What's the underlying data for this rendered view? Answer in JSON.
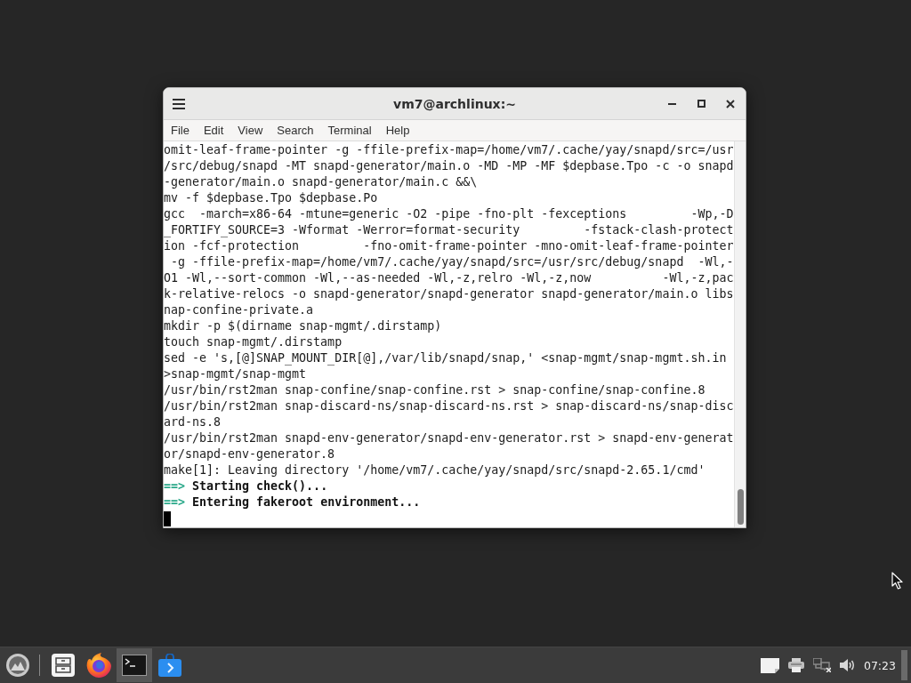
{
  "window": {
    "title": "vm7@archlinux:~"
  },
  "menu_bar": [
    "File",
    "Edit",
    "View",
    "Search",
    "Terminal",
    "Help"
  ],
  "terminal": {
    "lines": [
      {
        "kind": "output",
        "text": "omit-leaf-frame-pointer -g -ffile-prefix-map=/home/vm7/.cache/yay/snapd/src=/usr"
      },
      {
        "kind": "output",
        "text": "/src/debug/snapd -MT snapd-generator/main.o -MD -MP -MF $depbase.Tpo -c -o snapd"
      },
      {
        "kind": "output",
        "text": "-generator/main.o snapd-generator/main.c &&\\"
      },
      {
        "kind": "output",
        "text": "mv -f $depbase.Tpo $depbase.Po"
      },
      {
        "kind": "output",
        "text": "gcc  -march=x86-64 -mtune=generic -O2 -pipe -fno-plt -fexceptions         -Wp,-D"
      },
      {
        "kind": "output",
        "text": "_FORTIFY_SOURCE=3 -Wformat -Werror=format-security         -fstack-clash-protect"
      },
      {
        "kind": "output",
        "text": "ion -fcf-protection         -fno-omit-frame-pointer -mno-omit-leaf-frame-pointer"
      },
      {
        "kind": "output",
        "text": " -g -ffile-prefix-map=/home/vm7/.cache/yay/snapd/src=/usr/src/debug/snapd  -Wl,-"
      },
      {
        "kind": "output",
        "text": "O1 -Wl,--sort-common -Wl,--as-needed -Wl,-z,relro -Wl,-z,now          -Wl,-z,pac"
      },
      {
        "kind": "output",
        "text": "k-relative-relocs -o snapd-generator/snapd-generator snapd-generator/main.o libs"
      },
      {
        "kind": "output",
        "text": "nap-confine-private.a"
      },
      {
        "kind": "output",
        "text": "mkdir -p $(dirname snap-mgmt/.dirstamp)"
      },
      {
        "kind": "output",
        "text": "touch snap-mgmt/.dirstamp"
      },
      {
        "kind": "output",
        "text": "sed -e 's,[@]SNAP_MOUNT_DIR[@],/var/lib/snapd/snap,' <snap-mgmt/snap-mgmt.sh.in"
      },
      {
        "kind": "output",
        "text": ">snap-mgmt/snap-mgmt"
      },
      {
        "kind": "output",
        "text": "/usr/bin/rst2man snap-confine/snap-confine.rst > snap-confine/snap-confine.8"
      },
      {
        "kind": "output",
        "text": "/usr/bin/rst2man snap-discard-ns/snap-discard-ns.rst > snap-discard-ns/snap-disc"
      },
      {
        "kind": "output",
        "text": "ard-ns.8"
      },
      {
        "kind": "output",
        "text": "/usr/bin/rst2man snapd-env-generator/snapd-env-generator.rst > snapd-env-generat"
      },
      {
        "kind": "output",
        "text": "or/snapd-env-generator.8"
      },
      {
        "kind": "output",
        "text": "make[1]: Leaving directory '/home/vm7/.cache/yay/snapd/src/snapd-2.65.1/cmd'"
      },
      {
        "kind": "status",
        "arrow": "==>",
        "text": "Starting check()..."
      },
      {
        "kind": "status",
        "arrow": "==>",
        "text": "Entering fakeroot environment..."
      }
    ]
  },
  "taskbar": {
    "apps": [
      {
        "kind": "files",
        "selected": false
      },
      {
        "kind": "browser",
        "selected": false
      },
      {
        "kind": "terminal",
        "selected": true
      },
      {
        "kind": "store",
        "selected": false
      }
    ],
    "clock": "07:23"
  }
}
